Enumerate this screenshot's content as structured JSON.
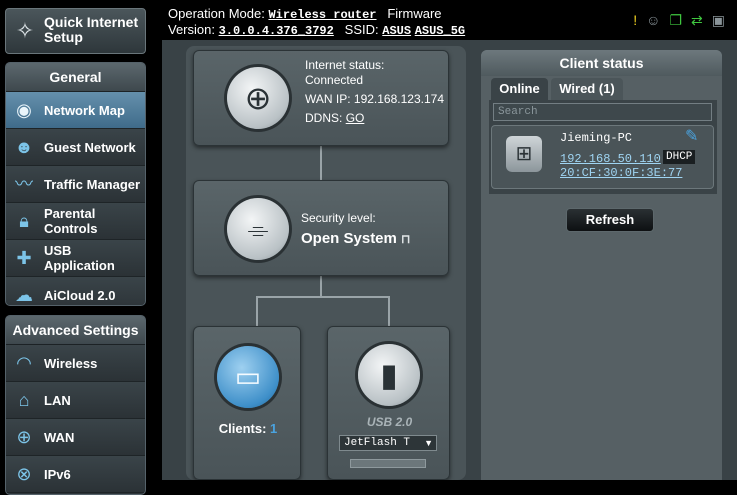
{
  "sidebar": {
    "quick_setup": {
      "label": "Quick Internet Setup",
      "icon": "magic-wand-icon"
    },
    "general": {
      "header": "General",
      "items": [
        {
          "label": "Network Map",
          "icon": "network-map-icon",
          "active": true
        },
        {
          "label": "Guest Network",
          "icon": "guest-users-icon"
        },
        {
          "label": "Traffic Manager",
          "icon": "traffic-chart-icon"
        },
        {
          "label": "Parental Controls",
          "icon": "lock-icon"
        },
        {
          "label": "USB Application",
          "icon": "puzzle-icon"
        },
        {
          "label": "AiCloud 2.0",
          "icon": "cloud-icon"
        }
      ]
    },
    "advanced": {
      "header": "Advanced Settings",
      "items": [
        {
          "label": "Wireless",
          "icon": "wifi-icon"
        },
        {
          "label": "LAN",
          "icon": "home-icon"
        },
        {
          "label": "WAN",
          "icon": "globe-icon"
        },
        {
          "label": "IPv6",
          "icon": "ipv6-globe-icon"
        }
      ]
    }
  },
  "topbar": {
    "op_mode_label": "Operation Mode:",
    "op_mode_value": "Wireless router",
    "firmware_label": "Firmware",
    "version_label": "Version:",
    "version_value": "3.0.0.4.376_3792",
    "ssid_label": "SSID:",
    "ssid_1": "ASUS",
    "ssid_2": "ASUS_5G",
    "icons": [
      "notification-icon",
      "users-icon",
      "copy-icon",
      "usb-icon",
      "printer-icon"
    ],
    "icon_colors": [
      "#f0d020",
      "#8a9499",
      "#3fc63f",
      "#3fc63f",
      "#8a9499"
    ]
  },
  "map": {
    "internet": {
      "status_label": "Internet status:",
      "status_value": "Connected",
      "wan_ip_label": "WAN IP:",
      "wan_ip_value": "192.168.123.174",
      "ddns_label": "DDNS:",
      "ddns_link": "GO"
    },
    "router": {
      "security_label": "Security level:",
      "security_value": "Open System"
    },
    "clients": {
      "label": "Clients:",
      "count": "1"
    },
    "usb": {
      "label": "USB 2.0",
      "device": "JetFlash T"
    }
  },
  "client_status": {
    "title": "Client status",
    "tabs": [
      "Online",
      "Wired (1)"
    ],
    "search_placeholder": "Search",
    "clients": [
      {
        "name": "Jieming-PC",
        "ip": "192.168.50.110",
        "type": "DHCP",
        "mac": "20:CF:30:0F:3E:77"
      }
    ],
    "refresh_label": "Refresh"
  },
  "colors": {
    "accent_blue": "#4aa3df",
    "nav_active": "#5583a3"
  }
}
